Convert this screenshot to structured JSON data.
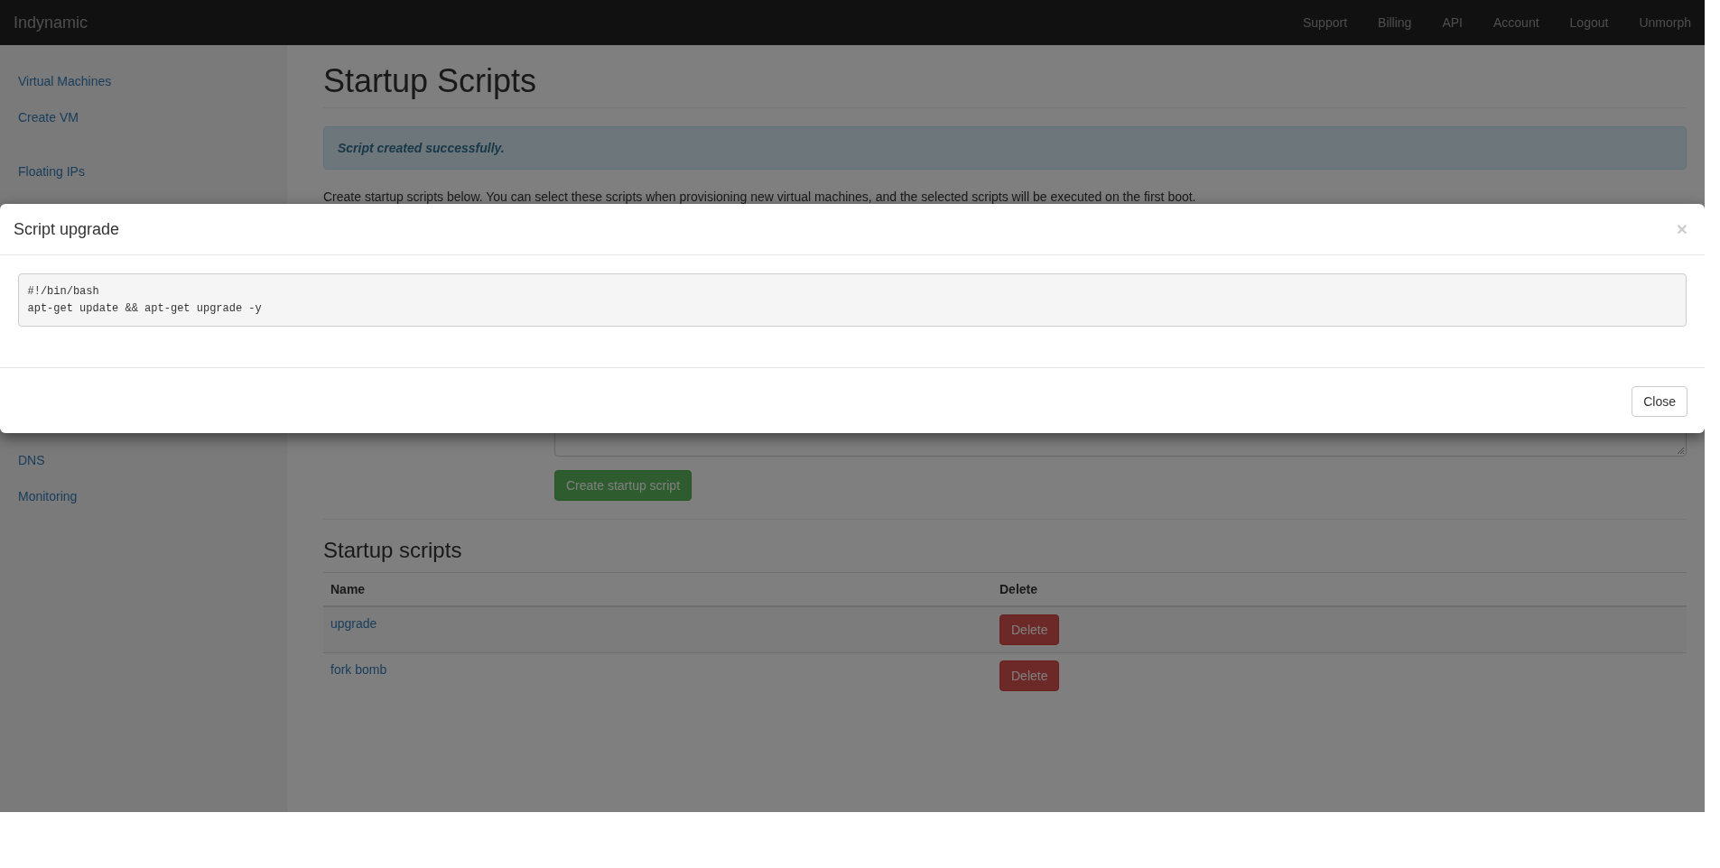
{
  "navbar": {
    "brand": "Indynamic",
    "links": [
      "Support",
      "Billing",
      "API",
      "Account",
      "Logout",
      "Unmorph"
    ]
  },
  "sidebar": {
    "groups": [
      [
        "Virtual Machines",
        "Create VM"
      ],
      [
        "Floating IPs"
      ],
      [
        "DNS",
        "Monitoring"
      ]
    ]
  },
  "page": {
    "title": "Startup Scripts",
    "alert": "Script created successfully.",
    "intro": "Create startup scripts below. You can select these scripts when provisioning new virtual machines, and the selected scripts will be executed on the first boot.",
    "create_button": "Create startup script",
    "list_title": "Startup scripts",
    "table": {
      "columns": [
        "Name",
        "Delete"
      ],
      "rows": [
        {
          "name": "upgrade",
          "action": "Delete"
        },
        {
          "name": "fork bomb",
          "action": "Delete"
        }
      ]
    }
  },
  "modal": {
    "title": "Script upgrade",
    "close_glyph": "×",
    "code": [
      "#!/bin/bash",
      "apt-get update && apt-get upgrade -y"
    ],
    "footer_button": "Close"
  }
}
